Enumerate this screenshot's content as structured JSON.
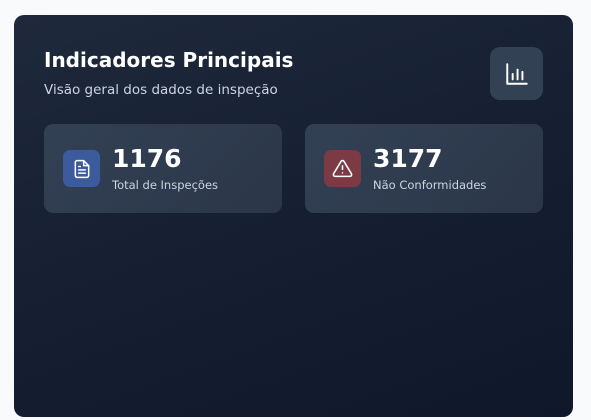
{
  "header": {
    "title": "Indicadores Principais",
    "subtitle": "Visão geral dos dados de inspeção",
    "chart_button_icon": "bar-chart-icon"
  },
  "metrics": [
    {
      "value": "1176",
      "label": "Total de Inspeções",
      "icon": "document-icon",
      "accent": "#3b5b9c"
    },
    {
      "value": "3177",
      "label": "Não Conformidades",
      "icon": "warning-triangle-icon",
      "accent": "#7b3a44"
    }
  ],
  "colors": {
    "page_background": "#f8fafc",
    "panel_background": "#1e293b",
    "card_background": "#334155",
    "text_primary": "#ffffff",
    "text_secondary": "#cbd5e1"
  }
}
